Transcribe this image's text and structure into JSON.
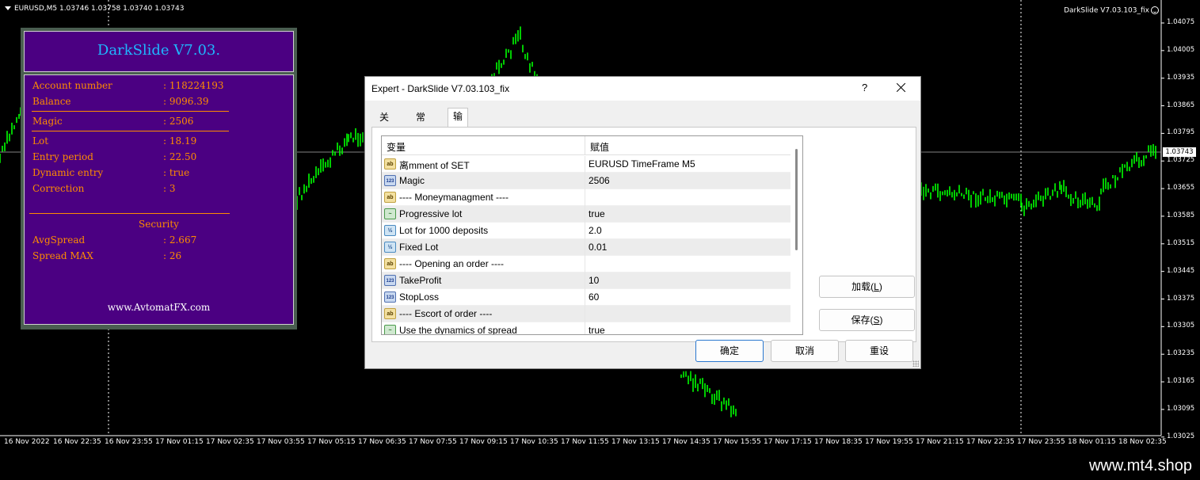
{
  "chart": {
    "symbol_header": "EURUSD,M5  1.03746 1.03758 1.03740 1.03743",
    "ea_label": "DarkSlide V7.03.103_fix",
    "price_ticks": [
      "1.04075",
      "1.04005",
      "1.03935",
      "1.03865",
      "1.03795",
      "1.03725",
      "1.03655",
      "1.03585",
      "1.03515",
      "1.03445",
      "1.03375",
      "1.03305",
      "1.03235",
      "1.03165",
      "1.03095",
      "1.03025"
    ],
    "current_price": "1.03743",
    "time_ticks": [
      "16 Nov 2022",
      "16 Nov 22:35",
      "16 Nov 23:55",
      "17 Nov 01:15",
      "17 Nov 02:35",
      "17 Nov 03:55",
      "17 Nov 05:15",
      "17 Nov 06:35",
      "17 Nov 07:55",
      "17 Nov 09:15",
      "17 Nov 10:35",
      "17 Nov 11:55",
      "17 Nov 13:15",
      "17 Nov 14:35",
      "17 Nov 15:55",
      "17 Nov 17:15",
      "17 Nov 18:35",
      "17 Nov 19:55",
      "17 Nov 21:15",
      "17 Nov 22:35",
      "17 Nov 23:55",
      "18 Nov 01:15",
      "18 Nov 02:35"
    ],
    "candle_color": "#00ff00",
    "grid_color": "#ffffff"
  },
  "info_panel": {
    "title": "DarkSlide V7.03.",
    "account_label": "Account number",
    "account_value": ": 118224193",
    "balance_label": "Balance",
    "balance_value": ": 9096.39",
    "magic_label": "Magic",
    "magic_value": ": 2506",
    "lot_label": "Lot",
    "lot_value": ": 18.19",
    "entry_label": "Entry period",
    "entry_value": ": 22.50",
    "dyn_label": "Dynamic entry",
    "dyn_value": ": true",
    "corr_label": "Correction",
    "corr_value": ": 3",
    "security_title": "Security",
    "avgspread_label": "AvgSpread",
    "avgspread_value": ": 2.667",
    "spreadmax_label": "Spread MAX",
    "spreadmax_value": ": 26",
    "website": "www.AvtomatFX.com",
    "accent_color": "#ff8c00",
    "background_color": "#4b0082"
  },
  "dialog": {
    "title": "Expert - DarkSlide V7.03.103_fix",
    "help": "?",
    "tabs": [
      "关于",
      "常用",
      "输入参数"
    ],
    "active_tab": "输入参数",
    "col_variable": "变量",
    "col_value": "赋值",
    "params": [
      {
        "icon": "ab",
        "name": "离mment of SET",
        "value": "EURUSD  TimeFrame M5"
      },
      {
        "icon": "123",
        "name": "Magic",
        "value": "2506"
      },
      {
        "icon": "ab",
        "name": "----    Moneymanagment    ----",
        "value": ""
      },
      {
        "icon": "bool",
        "name": "Progressive lot",
        "value": "true"
      },
      {
        "icon": "v2",
        "name": "Lot for 1000 deposits",
        "value": "2.0"
      },
      {
        "icon": "v2",
        "name": "Fixed Lot",
        "value": "0.01"
      },
      {
        "icon": "ab",
        "name": "----    Opening an order    ----",
        "value": ""
      },
      {
        "icon": "123",
        "name": "TakeProfit",
        "value": "10"
      },
      {
        "icon": "123",
        "name": "StopLoss",
        "value": "60"
      },
      {
        "icon": "ab",
        "name": "----    Escort of order    ----",
        "value": ""
      },
      {
        "icon": "bool",
        "name": "Use the dynamics of spread",
        "value": "true"
      }
    ],
    "load_label": "加载",
    "load_key": "L",
    "save_label": "保存",
    "save_key": "S",
    "ok_label": "确定",
    "cancel_label": "取消",
    "reset_label": "重设"
  },
  "footer": {
    "watermark": "www.mt4.shop"
  }
}
